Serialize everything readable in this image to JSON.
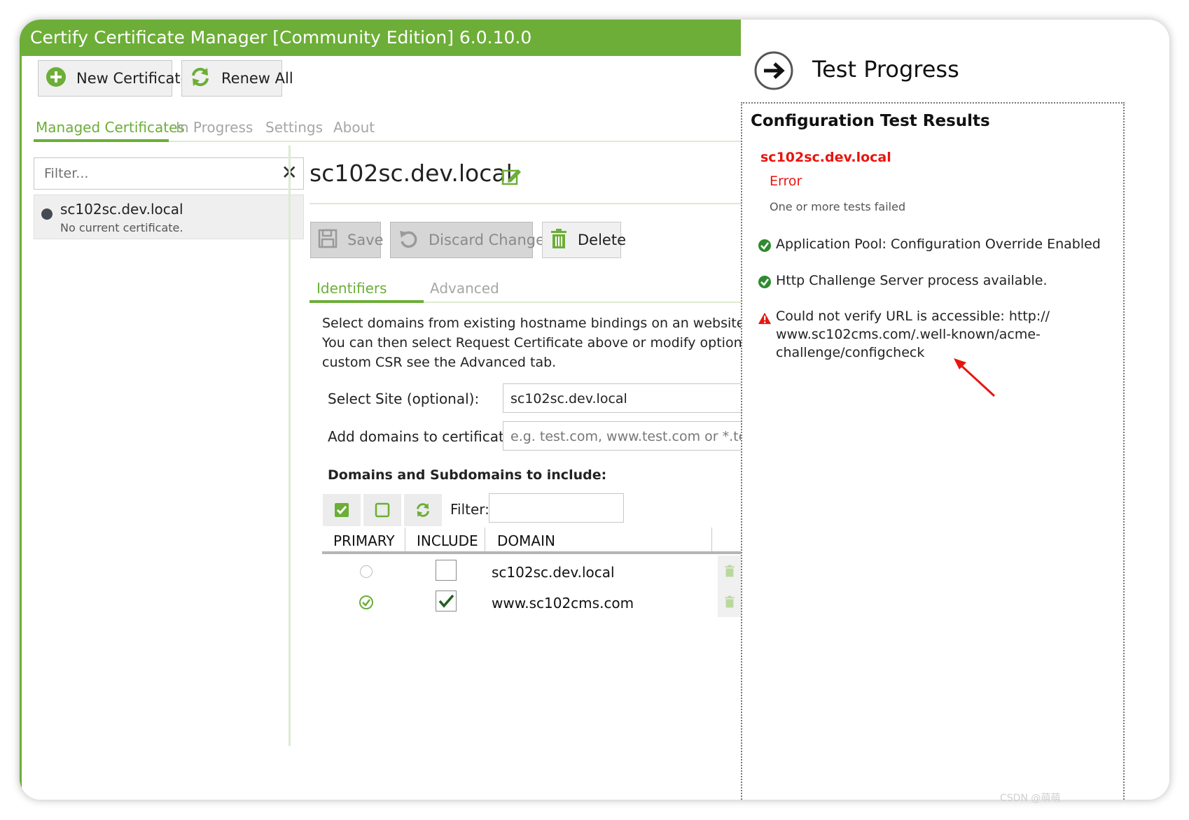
{
  "window": {
    "title": "Certify Certificate Manager [Community Edition] 6.0.10.0"
  },
  "toolbar": {
    "new_certificate": "New Certificate",
    "renew_all": "Renew All"
  },
  "nav_tabs": [
    {
      "label": "Managed Certificates",
      "active": true
    },
    {
      "label": "In Progress",
      "active": false
    },
    {
      "label": "Settings",
      "active": false
    },
    {
      "label": "About",
      "active": false
    }
  ],
  "sidebar": {
    "filter_placeholder": "Filter...",
    "items": [
      {
        "title": "sc102sc.dev.local",
        "subtitle": "No current certificate."
      }
    ]
  },
  "detail": {
    "title": "sc102sc.dev.local",
    "actions": {
      "save": "Save",
      "discard": "Discard Changes",
      "delete": "Delete"
    },
    "tabs": [
      {
        "label": "Identifiers",
        "active": true
      },
      {
        "label": "Advanced",
        "active": false
      }
    ],
    "intro_lines": [
      "Select domains from existing hostname bindings on an website or add",
      "You can then select Request Certificate above or modify options as req",
      "custom CSR see the Advanced tab."
    ],
    "select_site_label": "Select Site (optional):",
    "select_site_value": "sc102sc.dev.local",
    "add_domains_label": "Add domains to certificate:",
    "add_domains_placeholder": "e.g. test.com, www.test.com or *.test.c",
    "domains_heading": "Domains and Subdomains to include:",
    "filter_label": "Filter:",
    "table": {
      "headers": [
        "PRIMARY",
        "INCLUDE",
        "DOMAIN"
      ],
      "rows": [
        {
          "primary": false,
          "include": false,
          "domain": "sc102sc.dev.local"
        },
        {
          "primary": true,
          "include": true,
          "domain": "www.sc102cms.com"
        }
      ]
    }
  },
  "test_panel": {
    "title": "Test Progress",
    "heading": "Configuration Test Results",
    "domain": "sc102sc.dev.local",
    "status": "Error",
    "status_detail": "One or more tests failed",
    "results": [
      {
        "status": "ok",
        "lines": [
          "Application Pool: Configuration Override Enabled"
        ]
      },
      {
        "status": "ok",
        "lines": [
          "Http Challenge Server process available."
        ]
      },
      {
        "status": "warning",
        "lines": [
          "Could not verify URL is accessible: http://",
          "www.sc102cms.com/.well-known/acme-",
          "challenge/configcheck"
        ]
      }
    ]
  },
  "watermark": "CSDN @萌萌",
  "colors": {
    "accent": "#6cae37",
    "error": "#e8150f",
    "ok": "#2e8b2e"
  }
}
